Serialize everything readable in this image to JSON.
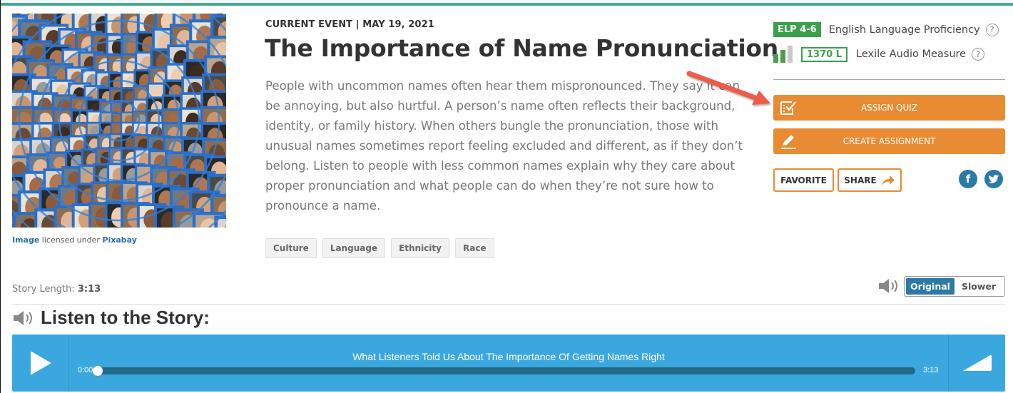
{
  "image": {
    "alt": "Mosaic of diverse faces arranged in a spherical grid",
    "credit_prefix": "Image",
    "credit_middle": " licensed under ",
    "credit_source": "Pixabay"
  },
  "article": {
    "kicker": "CURRENT EVENT | MAY 19, 2021",
    "title": "The Importance of Name Pronunciation",
    "summary": "People with uncommon names often hear them mispronounced. They say it can be annoying, but also hurtful. A person’s name often reflects their background, identity, or family history. When others bungle the pronunciation, those with unusual names sometimes report feeling excluded and different, as if they don’t belong. Listen to people with less common names explain why they care about proper pronunciation and what people can do when they’re not sure how to pronounce a name.",
    "tags": [
      "Culture",
      "Language",
      "Ethnicity",
      "Race"
    ]
  },
  "sidebar": {
    "elp_badge": "ELP 4-6",
    "elp_label": "English Language Proficiency",
    "lexile_badge": "1370 L",
    "lexile_label": "Lexile Audio Measure",
    "lexile_level_bars_filled": 2,
    "lexile_level_bars_total": 3,
    "help_symbol": "?",
    "assign_quiz_label": "ASSIGN QUIZ",
    "create_assignment_label": "CREATE ASSIGNMENT",
    "favorite_label": "FAVORITE",
    "share_label": "SHARE",
    "facebook_glyph": "f",
    "accent_color": "#e98b33",
    "green_color": "#3aa04b",
    "social_color": "#2b79a6"
  },
  "audio": {
    "story_length_label": "Story Length: ",
    "story_length_value": "3:13",
    "speed_options": [
      "Original",
      "Slower"
    ],
    "speed_selected": "Original",
    "listen_heading": "Listen to the Story:",
    "track_title": "What Listeners Told Us About The Importance Of Getting Names Right",
    "current_time": "0:00",
    "duration": "3:13",
    "progress_fraction": 0,
    "player_color": "#3aa8de"
  }
}
